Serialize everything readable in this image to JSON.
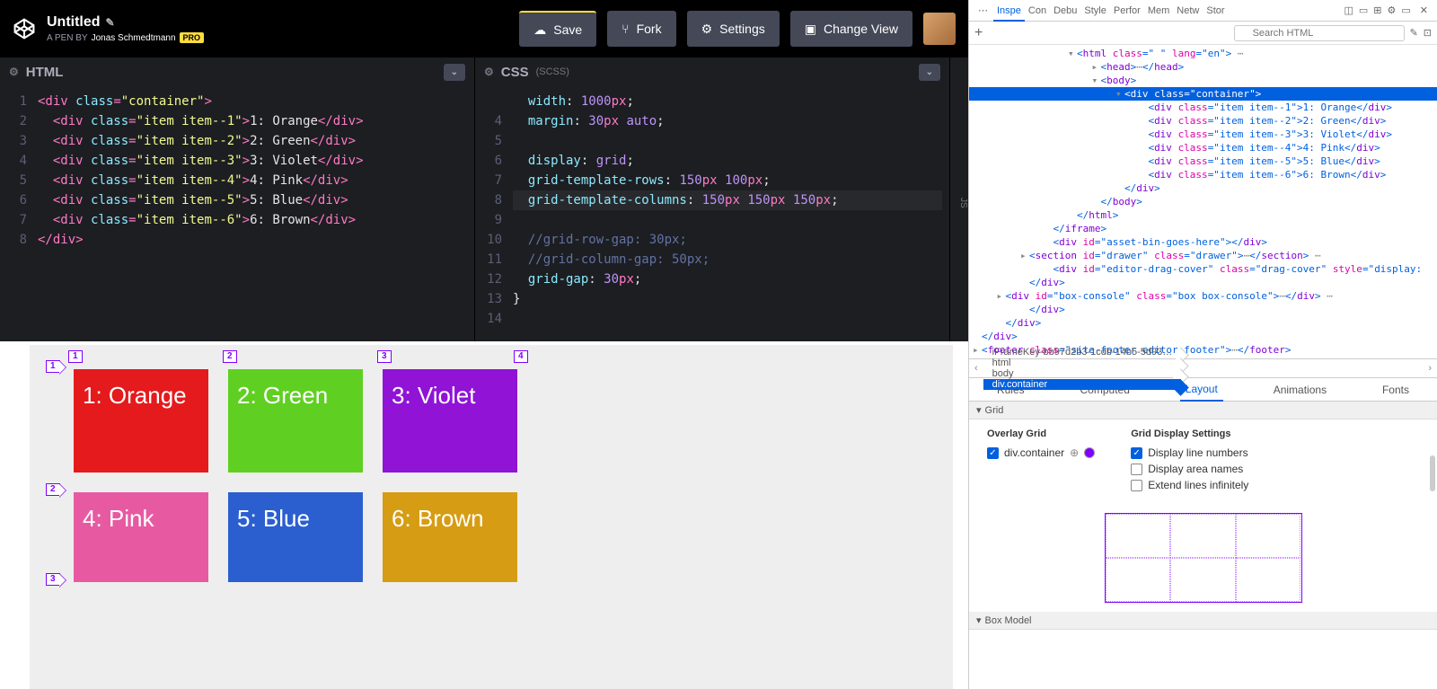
{
  "header": {
    "title": "Untitled",
    "pen_by": "A PEN BY",
    "author": "Jonas Schmedtmann",
    "pro": "PRO",
    "buttons": {
      "save": "Save",
      "fork": "Fork",
      "settings": "Settings",
      "change_view": "Change View"
    }
  },
  "editors": {
    "html": {
      "label": "HTML",
      "lines": [
        {
          "n": "1",
          "html": "<span class='tg'>&lt;div</span> <span class='at'>class</span><span class='eq'>=</span><span class='st'>\"container\"</span><span class='tg'>&gt;</span>"
        },
        {
          "n": "2",
          "html": "  <span class='tg'>&lt;div</span> <span class='at'>class</span><span class='eq'>=</span><span class='st'>\"item item--1\"</span><span class='tg'>&gt;</span><span class='tx'>1: Orange</span><span class='tg'>&lt;/div&gt;</span>"
        },
        {
          "n": "3",
          "html": "  <span class='tg'>&lt;div</span> <span class='at'>class</span><span class='eq'>=</span><span class='st'>\"item item--2\"</span><span class='tg'>&gt;</span><span class='tx'>2: Green</span><span class='tg'>&lt;/div&gt;</span>"
        },
        {
          "n": "4",
          "html": "  <span class='tg'>&lt;div</span> <span class='at'>class</span><span class='eq'>=</span><span class='st'>\"item item--3\"</span><span class='tg'>&gt;</span><span class='tx'>3: Violet</span><span class='tg'>&lt;/div&gt;</span>"
        },
        {
          "n": "5",
          "html": "  <span class='tg'>&lt;div</span> <span class='at'>class</span><span class='eq'>=</span><span class='st'>\"item item--4\"</span><span class='tg'>&gt;</span><span class='tx'>4: Pink</span><span class='tg'>&lt;/div&gt;</span>"
        },
        {
          "n": "6",
          "html": "  <span class='tg'>&lt;div</span> <span class='at'>class</span><span class='eq'>=</span><span class='st'>\"item item--5\"</span><span class='tg'>&gt;</span><span class='tx'>5: Blue</span><span class='tg'>&lt;/div&gt;</span>"
        },
        {
          "n": "7",
          "html": "  <span class='tg'>&lt;div</span> <span class='at'>class</span><span class='eq'>=</span><span class='st'>\"item item--6\"</span><span class='tg'>&gt;</span><span class='tx'>6: Brown</span><span class='tg'>&lt;/div&gt;</span>"
        },
        {
          "n": "8",
          "html": "<span class='tg'>&lt;/div&gt;</span>"
        }
      ]
    },
    "css": {
      "label": "CSS",
      "sublabel": "(SCSS)",
      "lines": [
        {
          "n": "",
          "html": "  <span class='pr'>width</span><span class='pn'>: </span><span class='vl'>1000</span><span class='un'>px</span><span class='pn'>;</span>"
        },
        {
          "n": "4",
          "html": "  <span class='pr'>margin</span><span class='pn'>: </span><span class='vl'>30</span><span class='un'>px</span> <span class='vl'>auto</span><span class='pn'>;</span>"
        },
        {
          "n": "5",
          "html": ""
        },
        {
          "n": "6",
          "html": "  <span class='pr'>display</span><span class='pn'>: </span><span class='vl'>grid</span><span class='pn'>;</span>"
        },
        {
          "n": "7",
          "html": "  <span class='pr'>grid-template-rows</span><span class='pn'>: </span><span class='vl'>150</span><span class='un'>px</span> <span class='vl'>100</span><span class='un'>px</span><span class='pn'>;</span>"
        },
        {
          "n": "8",
          "html": "  <span class='pr'>grid-template-columns</span><span class='pn'>: </span><span class='vl'>150</span><span class='un'>px</span> <span class='vl'>150</span><span class='un'>px</span> <span class='vl'>150</span><span class='un'>px</span><span class='pn'>;</span>"
        },
        {
          "n": "9",
          "html": ""
        },
        {
          "n": "10",
          "html": "  <span class='cm'>//grid-row-gap: 30px;</span>"
        },
        {
          "n": "11",
          "html": "  <span class='cm'>//grid-column-gap: 50px;</span>"
        },
        {
          "n": "12",
          "html": "  <span class='pr'>grid-gap</span><span class='pn'>: </span><span class='vl'>30</span><span class='un'>px</span><span class='pn'>;</span>"
        },
        {
          "n": "13",
          "html": "<span class='pn'>}</span>"
        },
        {
          "n": "14",
          "html": ""
        }
      ]
    },
    "js": {
      "label": "JS"
    }
  },
  "preview": {
    "cells": [
      {
        "text": "1: Orange",
        "bg": "#e41a1c"
      },
      {
        "text": "2: Green",
        "bg": "#5fd021"
      },
      {
        "text": "3: Violet",
        "bg": "#9013d6"
      },
      {
        "text": "4: Pink",
        "bg": "#e75aa2"
      },
      {
        "text": "5: Blue",
        "bg": "#2b5fd0"
      },
      {
        "text": "6: Brown",
        "bg": "#d69c13"
      }
    ],
    "row_labels": [
      "1",
      "2",
      "3"
    ],
    "col_labels": [
      "1",
      "2",
      "3",
      "4"
    ]
  },
  "devtools": {
    "tabs": [
      "Inspe",
      "Con",
      "Debu",
      "Style",
      "Perfor",
      "Mem",
      "Netw",
      "Stor"
    ],
    "active_tab": 0,
    "search_placeholder": "Search HTML",
    "dom": [
      {
        "ind": 8,
        "twisty": "▾",
        "html": "&lt;<span class='tag-blue'>html</span> <span class='attr'>class</span>=\"<span class='attrv'> </span>\" <span class='attr'>lang</span>=\"<span class='attrv'>en</span>\"&gt; <span class='gray'>⋯</span>"
      },
      {
        "ind": 10,
        "twisty": "▸",
        "html": "&lt;<span class='tag-blue'>head</span>&gt;<span class='gray'>⋯</span>&lt;/<span class='tag-blue'>head</span>&gt;"
      },
      {
        "ind": 10,
        "twisty": "▾",
        "html": "&lt;<span class='tag-blue'>body</span>&gt;"
      },
      {
        "ind": 12,
        "twisty": "▾",
        "sel": true,
        "html": "&lt;<span class='tag-blue'>div</span> <span class='attr'>class</span>=\"<span class='attrv'>container</span>\"&gt;"
      },
      {
        "ind": 14,
        "twisty": "",
        "html": "&lt;<span class='tag-blue'>div</span> <span class='attr'>class</span>=\"<span class='attrv'>item item--1</span>\"&gt;1: Orange&lt;/<span class='tag-blue'>div</span>&gt;"
      },
      {
        "ind": 14,
        "twisty": "",
        "html": "&lt;<span class='tag-blue'>div</span> <span class='attr'>class</span>=\"<span class='attrv'>item item--2</span>\"&gt;2: Green&lt;/<span class='tag-blue'>div</span>&gt;"
      },
      {
        "ind": 14,
        "twisty": "",
        "html": "&lt;<span class='tag-blue'>div</span> <span class='attr'>class</span>=\"<span class='attrv'>item item--3</span>\"&gt;3: Violet&lt;/<span class='tag-blue'>div</span>&gt;"
      },
      {
        "ind": 14,
        "twisty": "",
        "html": "&lt;<span class='tag-blue'>div</span> <span class='attr'>class</span>=\"<span class='attrv'>item item--4</span>\"&gt;4: Pink&lt;/<span class='tag-blue'>div</span>&gt;"
      },
      {
        "ind": 14,
        "twisty": "",
        "html": "&lt;<span class='tag-blue'>div</span> <span class='attr'>class</span>=\"<span class='attrv'>item item--5</span>\"&gt;5: Blue&lt;/<span class='tag-blue'>div</span>&gt;"
      },
      {
        "ind": 14,
        "twisty": "",
        "html": "&lt;<span class='tag-blue'>div</span> <span class='attr'>class</span>=\"<span class='attrv'>item item--6</span>\"&gt;6: Brown&lt;/<span class='tag-blue'>div</span>&gt;"
      },
      {
        "ind": 12,
        "twisty": "",
        "html": "&lt;/<span class='tag-blue'>div</span>&gt;"
      },
      {
        "ind": 10,
        "twisty": "",
        "html": "&lt;/<span class='tag-blue'>body</span>&gt;"
      },
      {
        "ind": 8,
        "twisty": "",
        "html": "&lt;/<span class='tag-blue'>html</span>&gt;"
      },
      {
        "ind": 6,
        "twisty": "",
        "html": "&lt;/<span class='tag-blue'>iframe</span>&gt;"
      },
      {
        "ind": 6,
        "twisty": "",
        "html": "&lt;<span class='tag-blue'>div</span> <span class='attr'>id</span>=\"<span class='attrv'>asset-bin-goes-here</span>\"&gt;&lt;/<span class='tag-blue'>div</span>&gt;"
      },
      {
        "ind": 4,
        "twisty": "▸",
        "html": "&lt;<span class='tag-blue'>section</span> <span class='attr'>id</span>=\"<span class='attrv'>drawer</span>\" <span class='attr'>class</span>=\"<span class='attrv'>drawer</span>\"&gt;<span class='gray'>⋯</span>&lt;/<span class='tag-blue'>section</span>&gt; <span class='gray'>⋯</span>"
      },
      {
        "ind": 6,
        "twisty": "",
        "html": "&lt;<span class='tag-blue'>div</span> <span class='attr'>id</span>=\"<span class='attrv'>editor-drag-cover</span>\" <span class='attr'>class</span>=\"<span class='attrv'>drag-cover</span>\" <span class='attr'>style</span>=\"<span class='attrv'>display:</span>"
      },
      {
        "ind": 4,
        "twisty": "",
        "html": "&lt;/<span class='tag-blue'>div</span>&gt;"
      },
      {
        "ind": 2,
        "twisty": "▸",
        "html": "&lt;<span class='tag-blue'>div</span> <span class='attr'>id</span>=\"<span class='attrv'>box-console</span>\" <span class='attr'>class</span>=\"<span class='attrv'>box box-console</span>\"&gt;<span class='gray'>⋯</span>&lt;/<span class='tag-blue'>div</span>&gt; <span class='gray'>⋯</span>"
      },
      {
        "ind": 4,
        "twisty": "",
        "html": "&lt;/<span class='tag-blue'>div</span>&gt;"
      },
      {
        "ind": 2,
        "twisty": "",
        "html": "&lt;/<span class='tag-blue'>div</span>&gt;"
      },
      {
        "ind": 0,
        "twisty": "",
        "html": "&lt;/<span class='tag-blue'>div</span>&gt;"
      },
      {
        "ind": 0,
        "twisty": "▸",
        "html": "&lt;<span class='tag-blue'>footer</span> <span class='attr'>class</span>=\"<span class='attrv'>site-footer editor-footer</span>\"&gt;<span class='gray'>⋯</span>&lt;/<span class='tag-blue'>footer</span>&gt;"
      }
    ],
    "breadcrumb": [
      "iFrameKey-bb97d2b3-1cdb-14b5-5d93…",
      "html",
      "body",
      "div.container"
    ],
    "subtabs": [
      "Rules",
      "Computed",
      "Layout",
      "Animations",
      "Fonts"
    ],
    "subtab_active": 2,
    "grid_section": "Grid",
    "overlay_grid_h": "Overlay Grid",
    "overlay_item": "div.container",
    "display_settings_h": "Grid Display Settings",
    "settings": [
      {
        "label": "Display line numbers",
        "on": true
      },
      {
        "label": "Display area names",
        "on": false
      },
      {
        "label": "Extend lines infinitely",
        "on": false
      }
    ],
    "box_model_h": "Box Model"
  }
}
